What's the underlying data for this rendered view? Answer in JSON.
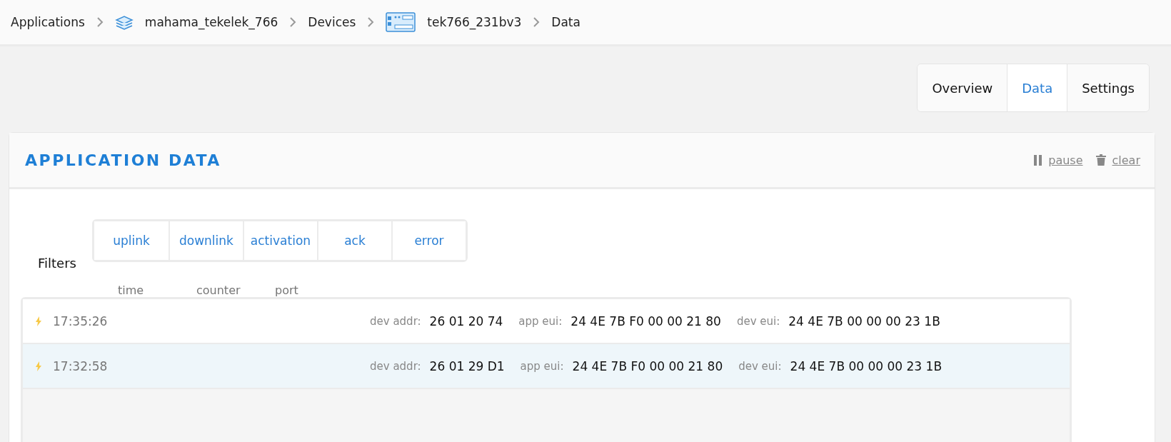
{
  "breadcrumb": [
    {
      "kind": "text",
      "label": "Applications"
    },
    {
      "kind": "app",
      "label": "mahama_tekelek_766"
    },
    {
      "kind": "text",
      "label": "Devices"
    },
    {
      "kind": "device",
      "label": "tek766_231bv3"
    },
    {
      "kind": "text",
      "label": "Data"
    }
  ],
  "tabs": [
    {
      "label": "Overview",
      "selected": false
    },
    {
      "label": "Data",
      "selected": true
    },
    {
      "label": "Settings",
      "selected": false
    }
  ],
  "panel": {
    "title": "APPLICATION DATA",
    "actions": [
      {
        "kind": "pause",
        "label": "pause"
      },
      {
        "kind": "clear",
        "label": "clear"
      }
    ]
  },
  "filters": {
    "label": "Filters",
    "options": [
      "uplink",
      "downlink",
      "activation",
      "ack",
      "error"
    ]
  },
  "columns": [
    "time",
    "counter",
    "port"
  ],
  "rows": [
    {
      "time": "17:35:26",
      "highlighted": false,
      "fields": [
        {
          "label": "dev addr:",
          "value": "26 01 20 74"
        },
        {
          "label": "app eui:",
          "value": "24 4E 7B F0 00 00 21 80"
        },
        {
          "label": "dev eui:",
          "value": "24 4E 7B 00 00 00 23 1B"
        }
      ]
    },
    {
      "time": "17:32:58",
      "highlighted": true,
      "fields": [
        {
          "label": "dev addr:",
          "value": "26 01 29 D1"
        },
        {
          "label": "app eui:",
          "value": "24 4E 7B F0 00 00 21 80"
        },
        {
          "label": "dev eui:",
          "value": "24 4E 7B 00 00 00 23 1B"
        }
      ]
    }
  ]
}
